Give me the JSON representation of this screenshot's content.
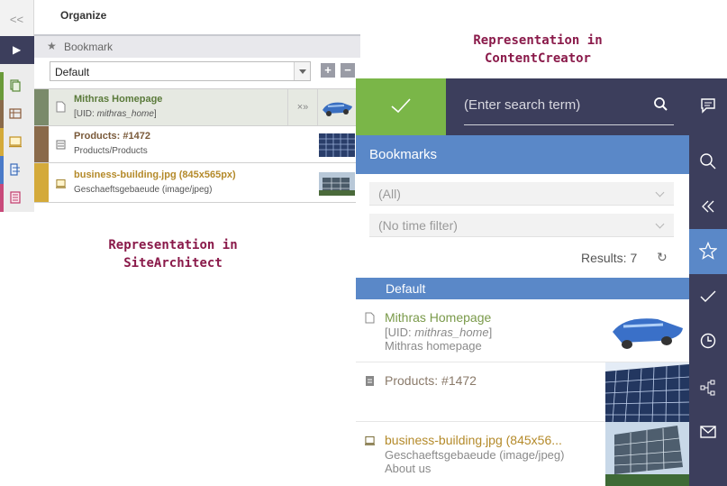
{
  "site_architect": {
    "collapse_label": "<<",
    "organize_title": "Organize",
    "bookmark_header": "Bookmark",
    "folder_select_value": "Default",
    "add_label": "+",
    "remove_label": "−",
    "items": [
      {
        "title": "Mithras Homepage",
        "subtitle_prefix": "[UID: ",
        "subtitle_uid": "mithras_home",
        "subtitle_suffix": "]",
        "actions": "×»"
      },
      {
        "title": "Products: #1472",
        "subtitle": "Products/Products"
      },
      {
        "title": "business-building.jpg (845x565px)",
        "subtitle": "Geschaeftsgebaeude (image/jpeg)"
      }
    ]
  },
  "labels": {
    "site_architect_line1": "Representation in",
    "site_architect_line2": "SiteArchitect",
    "content_creator_line1": "Representation in",
    "content_creator_line2": "ContentCreator"
  },
  "content_creator": {
    "search_placeholder": "(Enter search term)",
    "panel_title": "Bookmarks",
    "filter_type": "(All)",
    "filter_time": "(No time filter)",
    "results_text": "Results: 7",
    "group_label": "Default",
    "items": [
      {
        "name": "Mithras Homepage",
        "line2_prefix": "[UID: ",
        "line2_uid": "mithras_home",
        "line2_suffix": "]",
        "line3": "Mithras homepage"
      },
      {
        "name": "Products: #1472"
      },
      {
        "name": "business-building.jpg (845x56...",
        "line2": "Geschaeftsgebaeude (image/jpeg)",
        "line3": "About us"
      }
    ]
  },
  "colors": {
    "accent_blue": "#5a88c8",
    "dark_bar": "#3c3e5c",
    "confirm_green": "#7ab648",
    "label_red": "#8a1a4a",
    "item_green_title": "#6a8a3a",
    "item_gold_title": "#b48a2a",
    "item_brown_title": "#7a5a3a"
  },
  "icons": {
    "sa_tabs": [
      "play-icon",
      "pages-icon",
      "table-icon",
      "media-icon",
      "structure-icon",
      "templates-icon"
    ],
    "cc_rail": [
      "feedback-icon",
      "search-icon",
      "collapse-icon",
      "bookmark-star-icon",
      "check-icon",
      "history-icon",
      "hierarchy-icon",
      "mail-icon"
    ]
  }
}
